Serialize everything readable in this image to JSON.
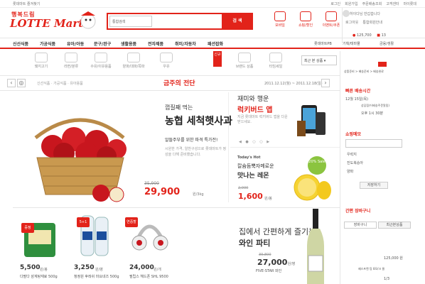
{
  "topbar": {
    "favorite": "롯데마트 즐겨찾기",
    "links": [
      "로그인",
      "회원가입",
      "주문배송조회",
      "고객센터",
      "마이롯데"
    ]
  },
  "logo": {
    "line1": "행복드림",
    "line2": "LOTTE Mart"
  },
  "search": {
    "select": "통합검색",
    "button": "검 색"
  },
  "quick_icons": [
    "모바일",
    "쇼핑/할인",
    "이벤트/쿠폰"
  ],
  "user": {
    "greeting": "하이다님 반갑습니다",
    "links": [
      "로그아웃",
      "통합회원안내"
    ],
    "points": "125,700",
    "coupons": "13"
  },
  "nav": [
    "신선식품",
    "가공식품",
    "유아/아동",
    "문구/완구",
    "생활용품",
    "전자제품",
    "취미/자동차",
    "패션잡화"
  ],
  "nav_right": [
    "롯데마트PB",
    "기획/테마몰",
    "금융/생활"
  ],
  "categories": [
    "돼지고기",
    "라면/분류",
    "수유/이유용품",
    "양파/대파/쪽파",
    "우유",
    "브랜드 상품",
    "타임세일"
  ],
  "new_tab": "신규",
  "recent": "최근 본 상품",
  "band": {
    "links": "신선식품 · 가공식품 · 유아용품",
    "title": "금주의 전단",
    "date": "2011.12.12(월) ~ 2011.12.18(일)"
  },
  "hero": {
    "t1": "껍질째 먹는",
    "t2": "농협 세척햇사과",
    "t3": "알뜰주부를 위한 파격 특가전!",
    "t4": "시원한 가격, 알찬구성으로 롯데마트가 정성을 다해 준비했습니다.",
    "old_price": "35,900",
    "price": "29,900",
    "unit": "원/3kg"
  },
  "app_promo": {
    "t1": "재미와 행운",
    "t2": "럭키버드 앱",
    "t3": "지금 롯데마트 럭키버드 앱을 다운받으세요."
  },
  "lemon": {
    "tag": "Today's Hot",
    "t1": "칼슘듬뿍자메로운",
    "t2": "맛나는 레몬",
    "badge": "20% Sale",
    "old_price": "2,000",
    "price": "1,600",
    "unit": "원/봉"
  },
  "products": [
    {
      "badge": "증정",
      "price": "5,500",
      "unit": "원/봉",
      "name": "다팔다 삼계탕재료 500g"
    },
    {
      "badge": "5+1",
      "price": "3,250",
      "unit": "원/병",
      "name": "청정원 후레쉬 마요네즈 500g"
    },
    {
      "badge": "연중할인",
      "price": "24,000",
      "unit": "원/개",
      "name": "필립스 헤드폰 SHL 9500"
    }
  ],
  "wine": {
    "t1": "집에서 간편하게 즐기는",
    "t2": "와인 파티",
    "old_price": "39,800",
    "price": "27,000",
    "unit": "원/병",
    "name": "FIVE-STAR 와인"
  },
  "sidebar": {
    "cart_path": "상품준비 > 배송준비 > 배송완료",
    "delivery_title": "빠른 배송시간",
    "delivery_date": "12월 15일(목)",
    "delivery_text": "상담접수(배송주문알림)",
    "delivery_time": "오후 1시 30분",
    "memo_title": "쇼핑메모",
    "memo_items": [
      "우럭지",
      "진도복숭아",
      "양파"
    ],
    "memo_btn": "저장하기",
    "cart_title": "간편 장바구니",
    "cart_tab1": "장바구니",
    "cart_tab2": "최근본상품",
    "cart_price": "125,000 원",
    "cart_item": "혜스프렌 탕 8모/크 물",
    "cart_page": "1/3"
  }
}
